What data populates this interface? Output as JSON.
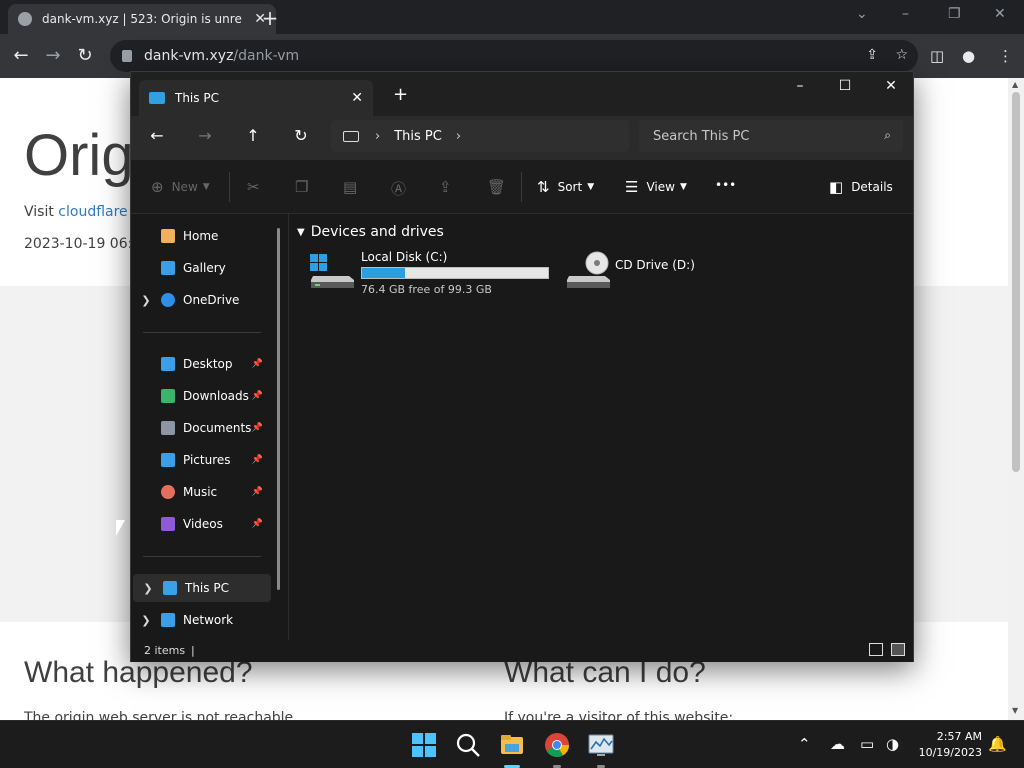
{
  "browser": {
    "tab_title": "dank-vm.xyz | 523: Origin is unre",
    "url_host": "dank-vm.xyz",
    "url_path": "/dank-vm",
    "window_controls": {
      "minimize": "–",
      "restore": "❐",
      "close": "✕",
      "dropdown": "⌄"
    },
    "new_tab": "+"
  },
  "webpage": {
    "title": "Orig",
    "visit_prefix": "Visit",
    "visit_link": "cloudflare",
    "date": "2023-10-19 06:",
    "heading_left": "What happened?",
    "heading_right": "What can I do?",
    "para_left": "The origin web server is not reachable.",
    "para_right": "If you're a visitor of this website:"
  },
  "explorer": {
    "tab_title": "This PC",
    "address": {
      "crumb": "This PC"
    },
    "search_placeholder": "Search This PC",
    "commands": {
      "new": "New",
      "sort": "Sort",
      "view": "View",
      "more": "•••",
      "details": "Details"
    },
    "sidebar": {
      "items": [
        {
          "label": "Home",
          "icon": "home-icon",
          "color": "#f2b05e"
        },
        {
          "label": "Gallery",
          "icon": "gallery-icon",
          "color": "#3aa0e8"
        },
        {
          "label": "OneDrive",
          "icon": "onedrive-icon",
          "color": "#2f8fe8"
        }
      ],
      "pinned": [
        {
          "label": "Desktop",
          "icon": "desktop-icon",
          "color": "#3aa0e8"
        },
        {
          "label": "Downloads",
          "icon": "downloads-icon",
          "color": "#3bb56c"
        },
        {
          "label": "Documents",
          "icon": "documents-icon",
          "color": "#8f96a3"
        },
        {
          "label": "Pictures",
          "icon": "pictures-icon",
          "color": "#3aa0e8"
        },
        {
          "label": "Music",
          "icon": "music-icon",
          "color": "#e2705c"
        },
        {
          "label": "Videos",
          "icon": "videos-icon",
          "color": "#8e5ad8"
        }
      ],
      "bottom": [
        {
          "label": "This PC",
          "icon": "this-pc-icon",
          "color": "#3aa0e8"
        },
        {
          "label": "Network",
          "icon": "network-icon",
          "color": "#3aa0e8"
        }
      ]
    },
    "group_header": "Devices and drives",
    "drives": [
      {
        "name": "Local Disk (C:)",
        "free": "76.4 GB free of 99.3 GB",
        "used_fraction": 0.23
      },
      {
        "name": "CD Drive (D:)"
      }
    ],
    "status": {
      "items": "2 items"
    }
  },
  "taskbar": {
    "time": "2:57 AM",
    "date": "10/19/2023"
  }
}
